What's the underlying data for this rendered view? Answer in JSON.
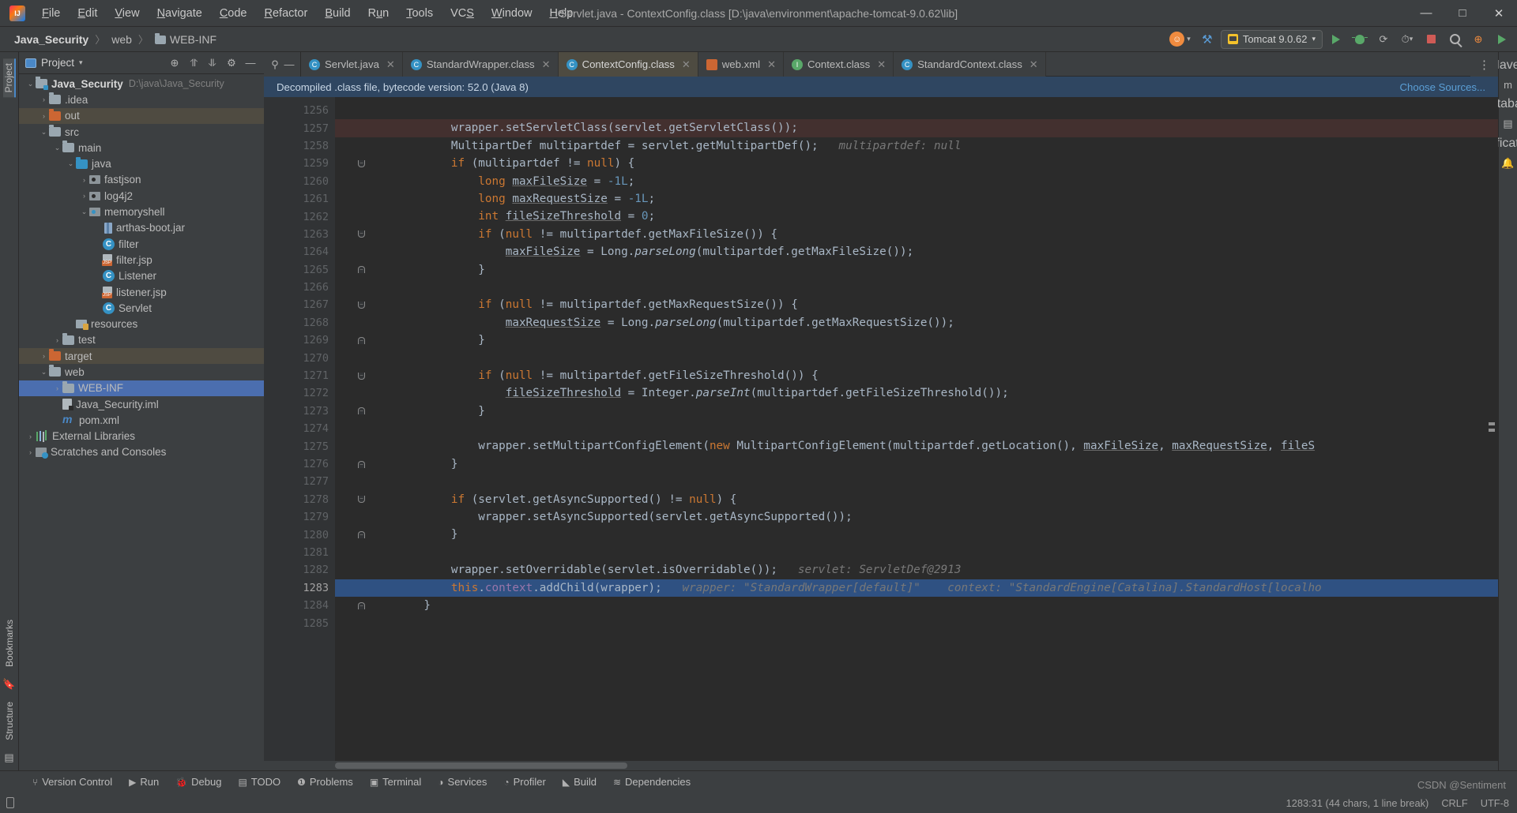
{
  "window": {
    "title": "Servlet.java - ContextConfig.class [D:\\java\\environment\\apache-tomcat-9.0.62\\lib]",
    "minimize": "—",
    "maximize": "□",
    "close": "✕"
  },
  "menu": [
    {
      "label": "File"
    },
    {
      "label": "Edit"
    },
    {
      "label": "View"
    },
    {
      "label": "Navigate"
    },
    {
      "label": "Code"
    },
    {
      "label": "Refactor"
    },
    {
      "label": "Build"
    },
    {
      "label": "Run"
    },
    {
      "label": "Tools"
    },
    {
      "label": "VCS"
    },
    {
      "label": "Window"
    },
    {
      "label": "Help"
    }
  ],
  "navbar": {
    "crumbs": [
      {
        "label": "Java_Security",
        "bold": true,
        "icon": ""
      },
      {
        "label": "web",
        "bold": false,
        "icon": ""
      },
      {
        "label": "WEB-INF",
        "bold": false,
        "icon": "folder-icon"
      }
    ],
    "separator": "〉",
    "run_config": "Tomcat 9.0.62",
    "run_config_dropdown": "▾",
    "account_icon": "user-avatar-icon",
    "search_icon": "search-icon",
    "build_icon": "hammer-icon",
    "updates_icon": "update-icon",
    "run_icon": "run-icon",
    "debug_icon": "debug-icon",
    "coverage_icon": "coverage-icon",
    "profile_icon": "profile-icon",
    "stop_icon": "stop-icon"
  },
  "left_rail": {
    "top": "Project",
    "items": [
      "Bookmarks",
      "Structure"
    ]
  },
  "right_rail": {
    "items": [
      "Maven",
      "Database",
      "Notifications"
    ]
  },
  "project_panel": {
    "title": "Project",
    "dropdown": "▾",
    "buttons": [
      "target-icon",
      "collapse-icon",
      "expand-icon",
      "settings-icon",
      "hide-icon"
    ],
    "tree": [
      {
        "depth": 0,
        "arrow": "v",
        "icon": "module",
        "label": "Java_Security",
        "bold": true,
        "path": "D:\\java\\Java_Security",
        "state": "normal"
      },
      {
        "depth": 1,
        "arrow": ">",
        "icon": "folder",
        "label": ".idea",
        "bold": false,
        "path": "",
        "state": "normal"
      },
      {
        "depth": 1,
        "arrow": ">",
        "icon": "folder-orange",
        "label": "out",
        "bold": false,
        "path": "",
        "state": "excluded"
      },
      {
        "depth": 1,
        "arrow": "v",
        "icon": "folder",
        "label": "src",
        "bold": false,
        "path": "",
        "state": "normal"
      },
      {
        "depth": 2,
        "arrow": "v",
        "icon": "folder",
        "label": "main",
        "bold": false,
        "path": "",
        "state": "normal"
      },
      {
        "depth": 3,
        "arrow": "v",
        "icon": "folder-blue",
        "label": "java",
        "bold": false,
        "path": "",
        "state": "normal"
      },
      {
        "depth": 4,
        "arrow": ">",
        "icon": "package",
        "label": "fastjson",
        "bold": false,
        "path": "",
        "state": "normal"
      },
      {
        "depth": 4,
        "arrow": ">",
        "icon": "package",
        "label": "log4j2",
        "bold": false,
        "path": "",
        "state": "normal"
      },
      {
        "depth": 4,
        "arrow": "v",
        "icon": "package-on",
        "label": "memoryshell",
        "bold": false,
        "path": "",
        "state": "normal"
      },
      {
        "depth": 5,
        "arrow": "",
        "icon": "jar",
        "label": "arthas-boot.jar",
        "bold": false,
        "path": "",
        "state": "normal"
      },
      {
        "depth": 5,
        "arrow": "",
        "icon": "class",
        "label": "filter",
        "bold": false,
        "path": "",
        "state": "normal"
      },
      {
        "depth": 5,
        "arrow": "",
        "icon": "jsp",
        "label": "filter.jsp",
        "bold": false,
        "path": "",
        "state": "normal"
      },
      {
        "depth": 5,
        "arrow": "",
        "icon": "class",
        "label": "Listener",
        "bold": false,
        "path": "",
        "state": "normal"
      },
      {
        "depth": 5,
        "arrow": "",
        "icon": "jsp",
        "label": "listener.jsp",
        "bold": false,
        "path": "",
        "state": "normal"
      },
      {
        "depth": 5,
        "arrow": "",
        "icon": "class",
        "label": "Servlet",
        "bold": false,
        "path": "",
        "state": "normal"
      },
      {
        "depth": 3,
        "arrow": "",
        "icon": "resources",
        "label": "resources",
        "bold": false,
        "path": "",
        "state": "normal"
      },
      {
        "depth": 2,
        "arrow": ">",
        "icon": "folder",
        "label": "test",
        "bold": false,
        "path": "",
        "state": "normal"
      },
      {
        "depth": 1,
        "arrow": ">",
        "icon": "folder-orange",
        "label": "target",
        "bold": false,
        "path": "",
        "state": "excluded"
      },
      {
        "depth": 1,
        "arrow": "v",
        "icon": "folder",
        "label": "web",
        "bold": false,
        "path": "",
        "state": "normal"
      },
      {
        "depth": 2,
        "arrow": ">",
        "icon": "folder",
        "label": "WEB-INF",
        "bold": false,
        "path": "",
        "state": "selected"
      },
      {
        "depth": 2,
        "arrow": "",
        "icon": "iml",
        "label": "Java_Security.iml",
        "bold": false,
        "path": "",
        "state": "normal"
      },
      {
        "depth": 2,
        "arrow": "",
        "icon": "maven",
        "label": "pom.xml",
        "bold": false,
        "path": "",
        "state": "normal"
      },
      {
        "depth": 0,
        "arrow": ">",
        "icon": "library",
        "label": "External Libraries",
        "bold": false,
        "path": "",
        "state": "normal"
      },
      {
        "depth": 0,
        "arrow": ">",
        "icon": "scratch",
        "label": "Scratches and Consoles",
        "bold": false,
        "path": "",
        "state": "normal"
      }
    ]
  },
  "editor": {
    "tabs": [
      {
        "label": "Servlet.java",
        "icon": "class-blue-icon",
        "active": false
      },
      {
        "label": "StandardWrapper.class",
        "icon": "class-blue-icon",
        "active": false
      },
      {
        "label": "ContextConfig.class",
        "icon": "class-blue-icon",
        "active": true
      },
      {
        "label": "web.xml",
        "icon": "xml-icon",
        "active": false
      },
      {
        "label": "Context.class",
        "icon": "interface-green-icon",
        "active": false
      },
      {
        "label": "StandardContext.class",
        "icon": "class-blue-icon",
        "active": false
      }
    ],
    "tab_close": "✕",
    "notice": "Decompiled .class file, bytecode version: 52.0 (Java 8)",
    "notice_action": "Choose Sources...",
    "lines": [
      {
        "no": "1256",
        "fold": "",
        "bp": false,
        "hl": "",
        "tokens": []
      },
      {
        "no": "1257",
        "fold": "",
        "bp": true,
        "hl": "bp",
        "tokens": [
          {
            "t": "        wrapper.setServletClass(servlet.getServletClass());",
            "c": "plain"
          }
        ]
      },
      {
        "no": "1258",
        "fold": "",
        "bp": false,
        "hl": "",
        "tokens": [
          {
            "t": "        MultipartDef multipartdef = servlet.getMultipartDef();",
            "c": "plain"
          },
          {
            "t": "   multipartdef: null",
            "c": "hint"
          }
        ]
      },
      {
        "no": "1259",
        "fold": "dn",
        "bp": false,
        "hl": "",
        "tokens": [
          {
            "t": "        ",
            "c": "plain"
          },
          {
            "t": "if",
            "c": "kw"
          },
          {
            "t": " (multipartdef != ",
            "c": "plain"
          },
          {
            "t": "null",
            "c": "kw"
          },
          {
            "t": ") {",
            "c": "plain"
          }
        ]
      },
      {
        "no": "1260",
        "fold": "",
        "bp": false,
        "hl": "",
        "tokens": [
          {
            "t": "            ",
            "c": "plain"
          },
          {
            "t": "long",
            "c": "kw"
          },
          {
            "t": " ",
            "c": "plain"
          },
          {
            "t": "maxFileSize",
            "c": "und"
          },
          {
            "t": " = ",
            "c": "plain"
          },
          {
            "t": "-1L",
            "c": "num"
          },
          {
            "t": ";",
            "c": "plain"
          }
        ]
      },
      {
        "no": "1261",
        "fold": "",
        "bp": false,
        "hl": "",
        "tokens": [
          {
            "t": "            ",
            "c": "plain"
          },
          {
            "t": "long",
            "c": "kw"
          },
          {
            "t": " ",
            "c": "plain"
          },
          {
            "t": "maxRequestSize",
            "c": "und"
          },
          {
            "t": " = ",
            "c": "plain"
          },
          {
            "t": "-1L",
            "c": "num"
          },
          {
            "t": ";",
            "c": "plain"
          }
        ]
      },
      {
        "no": "1262",
        "fold": "",
        "bp": false,
        "hl": "",
        "tokens": [
          {
            "t": "            ",
            "c": "plain"
          },
          {
            "t": "int",
            "c": "kw"
          },
          {
            "t": " ",
            "c": "plain"
          },
          {
            "t": "fileSizeThreshold",
            "c": "und"
          },
          {
            "t": " = ",
            "c": "plain"
          },
          {
            "t": "0",
            "c": "num"
          },
          {
            "t": ";",
            "c": "plain"
          }
        ]
      },
      {
        "no": "1263",
        "fold": "dn",
        "bp": false,
        "hl": "",
        "tokens": [
          {
            "t": "            ",
            "c": "plain"
          },
          {
            "t": "if",
            "c": "kw"
          },
          {
            "t": " (",
            "c": "plain"
          },
          {
            "t": "null",
            "c": "kw"
          },
          {
            "t": " != multipartdef.getMaxFileSize()) {",
            "c": "plain"
          }
        ]
      },
      {
        "no": "1264",
        "fold": "",
        "bp": false,
        "hl": "",
        "tokens": [
          {
            "t": "                ",
            "c": "plain"
          },
          {
            "t": "maxFileSize",
            "c": "und"
          },
          {
            "t": " = Long.",
            "c": "plain"
          },
          {
            "t": "parseLong",
            "c": "sta"
          },
          {
            "t": "(multipartdef.getMaxFileSize());",
            "c": "plain"
          }
        ]
      },
      {
        "no": "1265",
        "fold": "up",
        "bp": false,
        "hl": "",
        "tokens": [
          {
            "t": "            }",
            "c": "plain"
          }
        ]
      },
      {
        "no": "1266",
        "fold": "",
        "bp": false,
        "hl": "",
        "tokens": []
      },
      {
        "no": "1267",
        "fold": "dn",
        "bp": false,
        "hl": "",
        "tokens": [
          {
            "t": "            ",
            "c": "plain"
          },
          {
            "t": "if",
            "c": "kw"
          },
          {
            "t": " (",
            "c": "plain"
          },
          {
            "t": "null",
            "c": "kw"
          },
          {
            "t": " != multipartdef.getMaxRequestSize()) {",
            "c": "plain"
          }
        ]
      },
      {
        "no": "1268",
        "fold": "",
        "bp": false,
        "hl": "",
        "tokens": [
          {
            "t": "                ",
            "c": "plain"
          },
          {
            "t": "maxRequestSize",
            "c": "und"
          },
          {
            "t": " = Long.",
            "c": "plain"
          },
          {
            "t": "parseLong",
            "c": "sta"
          },
          {
            "t": "(multipartdef.getMaxRequestSize());",
            "c": "plain"
          }
        ]
      },
      {
        "no": "1269",
        "fold": "up",
        "bp": false,
        "hl": "",
        "tokens": [
          {
            "t": "            }",
            "c": "plain"
          }
        ]
      },
      {
        "no": "1270",
        "fold": "",
        "bp": false,
        "hl": "",
        "tokens": []
      },
      {
        "no": "1271",
        "fold": "dn",
        "bp": false,
        "hl": "",
        "tokens": [
          {
            "t": "            ",
            "c": "plain"
          },
          {
            "t": "if",
            "c": "kw"
          },
          {
            "t": " (",
            "c": "plain"
          },
          {
            "t": "null",
            "c": "kw"
          },
          {
            "t": " != multipartdef.getFileSizeThreshold()) {",
            "c": "plain"
          }
        ]
      },
      {
        "no": "1272",
        "fold": "",
        "bp": false,
        "hl": "",
        "tokens": [
          {
            "t": "                ",
            "c": "plain"
          },
          {
            "t": "fileSizeThreshold",
            "c": "und"
          },
          {
            "t": " = Integer.",
            "c": "plain"
          },
          {
            "t": "parseInt",
            "c": "sta"
          },
          {
            "t": "(multipartdef.getFileSizeThreshold());",
            "c": "plain"
          }
        ]
      },
      {
        "no": "1273",
        "fold": "up",
        "bp": false,
        "hl": "",
        "tokens": [
          {
            "t": "            }",
            "c": "plain"
          }
        ]
      },
      {
        "no": "1274",
        "fold": "",
        "bp": false,
        "hl": "",
        "tokens": []
      },
      {
        "no": "1275",
        "fold": "",
        "bp": false,
        "hl": "",
        "tokens": [
          {
            "t": "            wrapper.setMultipartConfigElement(",
            "c": "plain"
          },
          {
            "t": "new",
            "c": "kw"
          },
          {
            "t": " MultipartConfigElement(multipartdef.getLocation(), ",
            "c": "plain"
          },
          {
            "t": "maxFileSize",
            "c": "und"
          },
          {
            "t": ", ",
            "c": "plain"
          },
          {
            "t": "maxRequestSize",
            "c": "und"
          },
          {
            "t": ", ",
            "c": "plain"
          },
          {
            "t": "fileS",
            "c": "und"
          }
        ]
      },
      {
        "no": "1276",
        "fold": "up",
        "bp": false,
        "hl": "",
        "tokens": [
          {
            "t": "        }",
            "c": "plain"
          }
        ]
      },
      {
        "no": "1277",
        "fold": "",
        "bp": false,
        "hl": "",
        "tokens": []
      },
      {
        "no": "1278",
        "fold": "dn",
        "bp": false,
        "hl": "",
        "tokens": [
          {
            "t": "        ",
            "c": "plain"
          },
          {
            "t": "if",
            "c": "kw"
          },
          {
            "t": " (servlet.getAsyncSupported() != ",
            "c": "plain"
          },
          {
            "t": "null",
            "c": "kw"
          },
          {
            "t": ") {",
            "c": "plain"
          }
        ]
      },
      {
        "no": "1279",
        "fold": "",
        "bp": false,
        "hl": "",
        "tokens": [
          {
            "t": "            wrapper.setAsyncSupported(servlet.getAsyncSupported());",
            "c": "plain"
          }
        ]
      },
      {
        "no": "1280",
        "fold": "up",
        "bp": false,
        "hl": "",
        "tokens": [
          {
            "t": "        }",
            "c": "plain"
          }
        ]
      },
      {
        "no": "1281",
        "fold": "",
        "bp": false,
        "hl": "",
        "tokens": []
      },
      {
        "no": "1282",
        "fold": "",
        "bp": false,
        "hl": "",
        "tokens": [
          {
            "t": "        wrapper.setOverridable(servlet.isOverridable());",
            "c": "plain"
          },
          {
            "t": "   servlet: ServletDef@2913",
            "c": "hint"
          }
        ]
      },
      {
        "no": "1283",
        "fold": "",
        "bp": true,
        "hl": "sel",
        "tokens": [
          {
            "t": "        ",
            "c": "plain"
          },
          {
            "t": "this",
            "c": "kw"
          },
          {
            "t": ".",
            "c": "plain"
          },
          {
            "t": "context",
            "c": "fld"
          },
          {
            "t": ".addChild(wrapper);",
            "c": "plain"
          },
          {
            "t": "   wrapper: \"StandardWrapper[default]\"",
            "c": "hint"
          },
          {
            "t": "    context: \"StandardEngine[Catalina].StandardHost[localho",
            "c": "hint"
          }
        ]
      },
      {
        "no": "1284",
        "fold": "up",
        "bp": false,
        "hl": "",
        "tokens": [
          {
            "t": "    }",
            "c": "plain"
          }
        ]
      },
      {
        "no": "1285",
        "fold": "",
        "bp": false,
        "hl": "",
        "tokens": []
      }
    ]
  },
  "tool_windows": [
    {
      "label": "Version Control",
      "icon": "branch-icon"
    },
    {
      "label": "Run",
      "icon": "run-icon"
    },
    {
      "label": "Debug",
      "icon": "debug-icon"
    },
    {
      "label": "TODO",
      "icon": "todo-icon"
    },
    {
      "label": "Problems",
      "icon": "problems-icon"
    },
    {
      "label": "Terminal",
      "icon": "terminal-icon"
    },
    {
      "label": "Services",
      "icon": "services-icon"
    },
    {
      "label": "Profiler",
      "icon": "profiler-icon"
    },
    {
      "label": "Build",
      "icon": "build-icon"
    },
    {
      "label": "Dependencies",
      "icon": "dependencies-icon"
    }
  ],
  "status_bar": {
    "caret": "1283:31 (44 chars, 1 line break)",
    "line_separator": "CRLF",
    "encoding": "UTF-8",
    "watermark": "CSDN @Sentiment"
  },
  "colors": {
    "accent_blue": "#4b6eaf",
    "selection": "#2f5182",
    "breakpoint_red": "#db5c5c",
    "notice_bg": "#2f4661",
    "panel_bg": "#3c3f41",
    "editor_bg": "#2b2b2b"
  }
}
